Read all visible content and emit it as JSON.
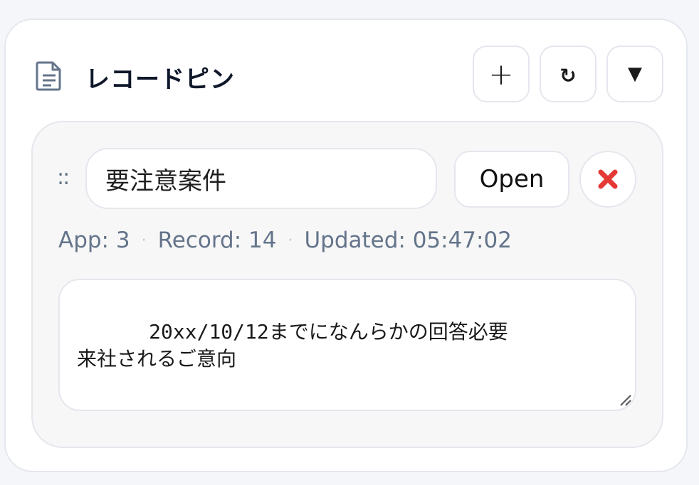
{
  "header": {
    "title": "レコードピン",
    "icon": "document-icon",
    "buttons": {
      "add": {
        "label": "+",
        "icon": "plus-icon"
      },
      "refresh": {
        "label": "↻",
        "icon": "refresh-icon"
      },
      "collapse": {
        "label": "▼",
        "icon": "triangle-down-icon"
      }
    }
  },
  "pin": {
    "drag_handle": "::",
    "name_value": "要注意案件",
    "open_label": "Open",
    "delete_icon": "close-x-icon",
    "delete_color": "#e53935",
    "meta": {
      "app": "App: 3",
      "record": "Record: 14",
      "updated": "Updated: 05:47:02",
      "separator": "·"
    },
    "note": "20xx/10/12までになんらかの回答必要\n来社されるご意向"
  },
  "colors": {
    "background": "#f4f6fa",
    "border": "#e4e7ed",
    "muted_text": "#64748b"
  }
}
